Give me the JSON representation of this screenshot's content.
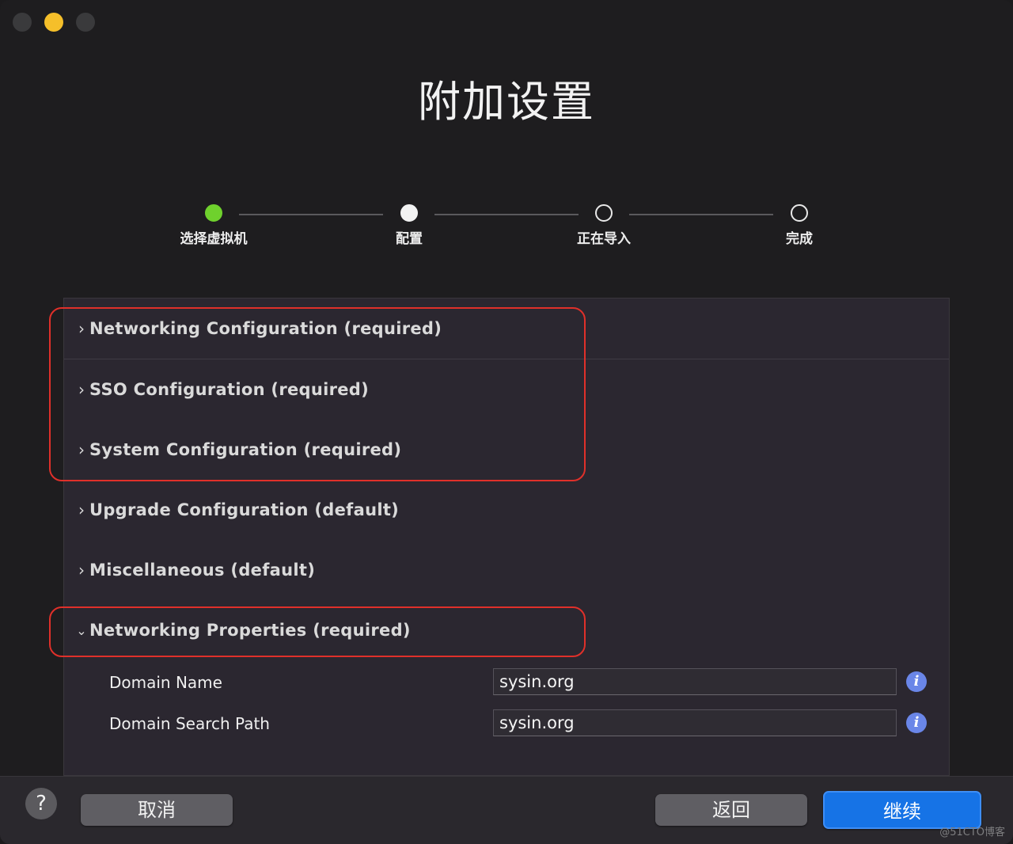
{
  "window": {
    "title": "附加设置",
    "colors": {
      "close": "#3a3a3c",
      "minimize": "#f5bf2a",
      "maximize": "#3a3a3c"
    }
  },
  "stepper": {
    "steps": [
      {
        "label": "选择虚拟机",
        "state": "done"
      },
      {
        "label": "配置",
        "state": "current"
      },
      {
        "label": "正在导入",
        "state": "pending"
      },
      {
        "label": "完成",
        "state": "pending"
      }
    ],
    "colors": {
      "done": "#6fd12d",
      "current": "#f2f2f2"
    }
  },
  "sections": [
    {
      "label": "Networking Configuration (required)",
      "expanded": false,
      "chevron": "chevron-right-icon"
    },
    {
      "label": "SSO Configuration (required)",
      "expanded": false,
      "chevron": "chevron-right-icon"
    },
    {
      "label": "System Configuration (required)",
      "expanded": false,
      "chevron": "chevron-right-icon"
    },
    {
      "label": "Upgrade Configuration (default)",
      "expanded": false,
      "chevron": "chevron-right-icon"
    },
    {
      "label": "Miscellaneous (default)",
      "expanded": false,
      "chevron": "chevron-right-icon"
    },
    {
      "label": "Networking Properties (required)",
      "expanded": true,
      "chevron": "chevron-down-icon"
    }
  ],
  "properties": [
    {
      "label": "Domain Name",
      "value": "sysin.org",
      "icon": "info-icon"
    },
    {
      "label": "Domain Search Path",
      "value": "sysin.org",
      "icon": "info-icon"
    }
  ],
  "highlight_color": "#e0302a",
  "footer": {
    "help": "?",
    "cancel": "取消",
    "back": "返回",
    "continue": "继续",
    "accent": "#1673e6"
  },
  "watermark": "@51CTO博客"
}
